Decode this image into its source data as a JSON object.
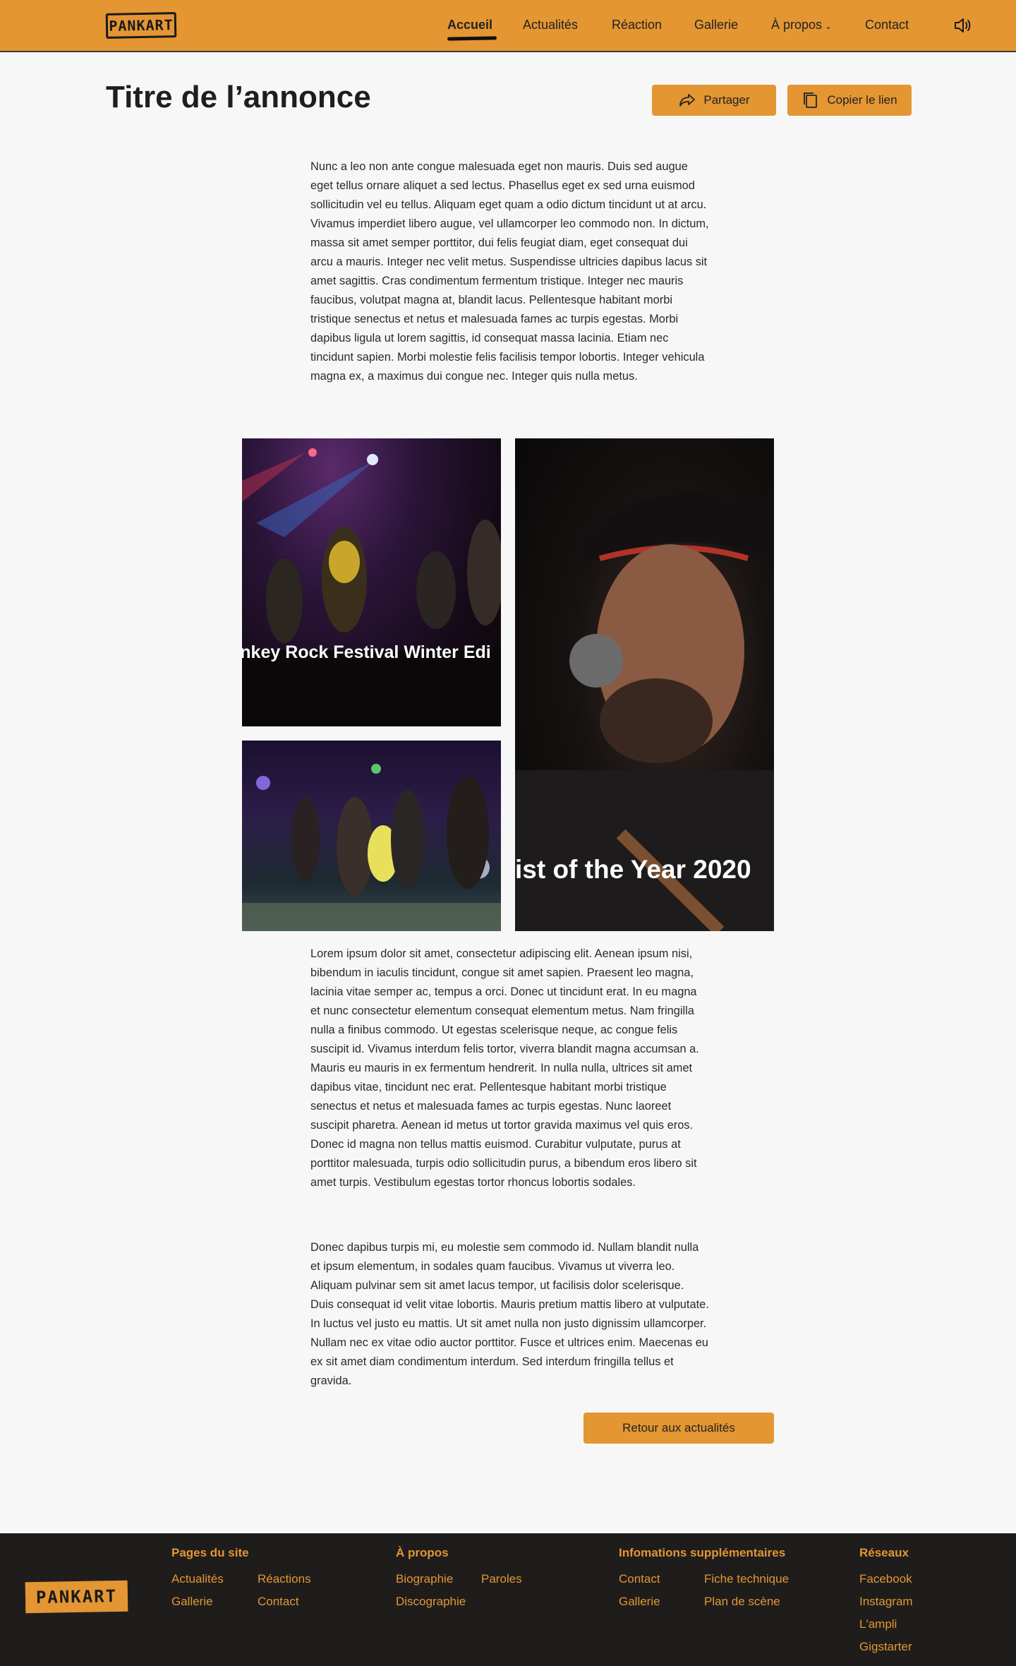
{
  "header": {
    "logo_text": "PANKART",
    "nav": [
      {
        "label": "Accueil",
        "active": true
      },
      {
        "label": "Actualités"
      },
      {
        "label": "Réaction"
      },
      {
        "label": "Gallerie"
      },
      {
        "label": "À propos",
        "dropdown": true
      },
      {
        "label": "Contact"
      }
    ],
    "chevron": "⌄",
    "sound_icon": "speaker-icon"
  },
  "main": {
    "title": "Titre de l’annonce",
    "share_label": "Partager",
    "copy_label": "Copier le lien",
    "intro": "Nunc a leo non ante congue malesuada eget non mauris. Duis sed augue eget tellus ornare aliquet a sed lectus. Phasellus eget ex sed urna euismod sollicitudin vel eu tellus. Aliquam eget quam a odio dictum tincidunt ut at arcu. Vivamus imperdiet libero augue, vel ullamcorper leo commodo non. In dictum, massa sit amet semper porttitor, dui felis feugiat diam, eget consequat dui arcu a mauris. Integer nec velit metus. Suspendisse ultricies dapibus lacus sit amet sagittis. Cras condimentum fermentum tristique. Integer nec mauris faucibus, volutpat magna at, blandit lacus. Pellentesque habitant morbi tristique senectus et netus et malesuada fames ac turpis egestas. Morbi dapibus ligula ut lorem sagittis, id consequat massa lacinia. Etiam nec tincidunt sapien. Morbi molestie felis facilisis tempor lobortis. Integer vehicula magna ex, a maximus dui congue nec. Integer quis nulla metus.",
    "photo1_caption": "onkey Rock Festival Winter Edi",
    "photo3_caption": "ist of the Year 2020",
    "body1": "Lorem ipsum dolor sit amet, consectetur adipiscing elit. Aenean ipsum nisi, bibendum in iaculis tincidunt, congue sit amet sapien. Praesent leo magna, lacinia vitae semper ac, tempus a orci. Donec ut tincidunt erat. In eu magna et nunc consectetur elementum consequat elementum metus. Nam fringilla nulla a finibus commodo. Ut egestas scelerisque neque, ac congue felis suscipit id. Vivamus interdum felis tortor, viverra blandit magna accumsan a. Mauris eu mauris in ex fermentum hendrerit. In nulla nulla, ultrices sit amet dapibus vitae, tincidunt nec erat. Pellentesque habitant morbi tristique senectus et netus et malesuada fames ac turpis egestas. Nunc laoreet suscipit pharetra. Aenean id metus ut tortor gravida maximus vel quis eros. Donec id magna non tellus mattis euismod. Curabitur vulputate, purus at porttitor malesuada, turpis odio sollicitudin purus, a bibendum eros libero sit amet turpis. Vestibulum egestas tortor rhoncus lobortis sodales.",
    "body2": "Donec dapibus turpis mi, eu molestie sem commodo id. Nullam blandit nulla et ipsum elementum, in sodales quam faucibus. Vivamus ut viverra leo. Aliquam pulvinar sem sit amet lacus tempor, ut facilisis dolor scelerisque. Duis consequat id velit vitae lobortis. Mauris pretium mattis libero at vulputate. In luctus vel justo eu mattis. Ut sit amet nulla non justo dignissim ullamcorper. Nullam nec ex vitae odio auctor porttitor. Fusce et ultrices enim. Maecenas eu ex sit amet diam condimentum interdum. Sed interdum fringilla tellus et gravida.",
    "back_label": "Retour aux actualités"
  },
  "footer": {
    "logo_text": "PANKART",
    "site_pages": {
      "heading": "Pages du site",
      "links": [
        "Actualités",
        "Réactions",
        "Gallerie",
        "Contact"
      ]
    },
    "about": {
      "heading": "À propos",
      "links": [
        "Biographie",
        "Paroles",
        "Discographie"
      ]
    },
    "info": {
      "heading": "Infomations supplémentaires",
      "links": [
        "Contact",
        "Fiche technique",
        "Gallerie",
        "Plan de scène"
      ]
    },
    "social": {
      "heading": "Réseaux",
      "links": [
        "Facebook",
        "Instagram",
        "L'ampli",
        "Gigstarter"
      ]
    }
  },
  "colors": {
    "accent": "#e49633",
    "footer_bg": "#1e1d1c",
    "page_bg": "#f7f7f7"
  }
}
